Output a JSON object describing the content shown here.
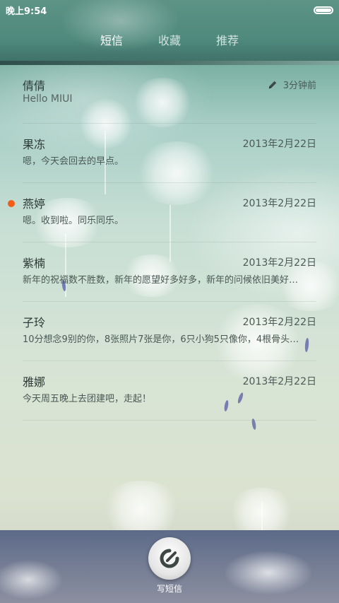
{
  "status_bar": {
    "time": "晚上9:54"
  },
  "tabs": [
    {
      "label": "短信",
      "active": true
    },
    {
      "label": "收藏",
      "active": false
    },
    {
      "label": "推荐",
      "active": false
    }
  ],
  "conversations": [
    {
      "name": "倩倩",
      "preview": "Hello MIUI",
      "date": "3分钟前",
      "draft": true,
      "unread": false
    },
    {
      "name": "果冻",
      "preview": "嗯，今天会回去的早点。",
      "date": "2013年2月22日",
      "draft": false,
      "unread": false
    },
    {
      "name": "燕婷",
      "preview": "嗯。收到啦。同乐同乐。",
      "date": "2013年2月22日",
      "draft": false,
      "unread": true
    },
    {
      "name": "紫楠",
      "preview": "新年的祝福数不胜数，新年的愿望好多好多，新年的问候依旧美好…",
      "date": "2013年2月22日",
      "draft": false,
      "unread": false
    },
    {
      "name": "子玲",
      "preview": "10分想念9别的你，8张照片7张是你，6只小狗5只像你，4根骨头…",
      "date": "2013年2月22日",
      "draft": false,
      "unread": false
    },
    {
      "name": "雅娜",
      "preview": "今天周五晚上去团建吧，走起！",
      "date": "2013年2月22日",
      "draft": false,
      "unread": false
    }
  ],
  "bottom": {
    "compose_label": "写短信"
  },
  "colors": {
    "unread_dot": "#f25d18",
    "accent_dark": "#3d4a47"
  },
  "icons": {
    "draft": "pencil-icon",
    "compose": "compose-icon",
    "battery": "battery-icon"
  }
}
